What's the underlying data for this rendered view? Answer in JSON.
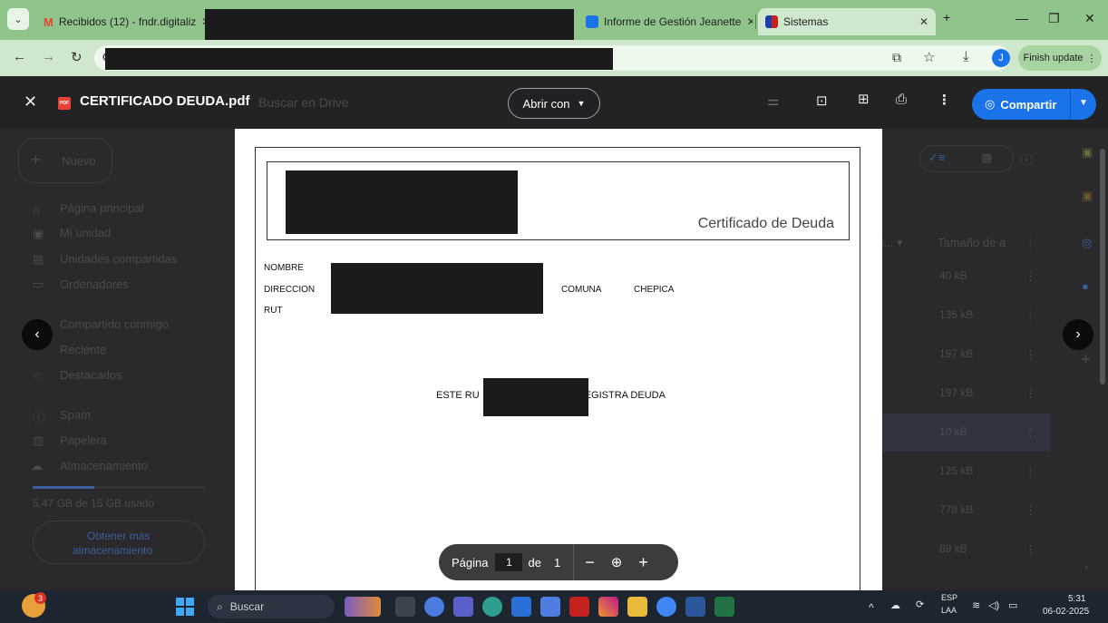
{
  "browser": {
    "tabs": [
      {
        "title": "Recibidos (12) - fndr.digitaliz",
        "favicon_color": "#ea4335",
        "active": false
      },
      {
        "title": "Informe de Gestión Jeanette",
        "favicon_color": "#1a73e8",
        "active": false
      },
      {
        "title": "Sistemas",
        "favicon_color": "#c5221f",
        "active": true
      }
    ],
    "new_tab": "+",
    "tabs_menu": "⌄",
    "minimize": "—",
    "restore": "❐",
    "close": "✕",
    "finish_update": "Finish update",
    "profile_initial": "J",
    "accent": "#8fc48a"
  },
  "viewer": {
    "file_title": "CERTIFICADO DEUDA.pdf",
    "pdf_badge": "PDF",
    "search_placeholder": "Buscar en Drive",
    "open_with": "Abrir con",
    "share": "Compartir",
    "page_label": "Página",
    "current_page": "1",
    "of_label": "de",
    "total_pages": "1"
  },
  "drive_background": {
    "new_button": "Nuevo",
    "nav": [
      "Página principal",
      "Mi unidad",
      "Unidades compartidas",
      "Ordenadores",
      "Compartido conmigo",
      "Reciente",
      "Destacados",
      "Spam",
      "Papelera",
      "Almacenamiento"
    ],
    "storage_used": "5,47 GB de 15 GB usado",
    "get_storage": [
      "Obtener más",
      "almacenamiento"
    ],
    "column_size": "Tamaño de a",
    "sizes": [
      "40 kB",
      "135 kB",
      "197 kB",
      "197 kB",
      "10 kB",
      "125 kB",
      "778 kB",
      "89 kB"
    ]
  },
  "pdf": {
    "certificate_title": "Certificado de Deuda",
    "labels": {
      "nombre": "NOMBRE",
      "direccion": "DIRECCION",
      "rut": "RUT",
      "comuna": "COMUNA",
      "comuna_value": "CHEPICA"
    },
    "statement_left": "ESTE RU",
    "statement_right": "EGISTRA DEUDA"
  },
  "taskbar": {
    "search": "Buscar",
    "badge": "3",
    "lang_top": "ESP",
    "lang_bottom": "LAA",
    "time": "5:31",
    "date": "06-02-2025"
  }
}
